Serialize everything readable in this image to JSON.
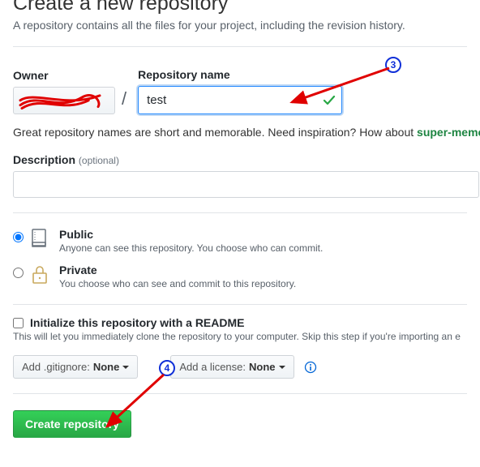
{
  "heading": "Create a new repository",
  "subheading": "A repository contains all the files for your project, including the revision history.",
  "owner": {
    "label": "Owner"
  },
  "repo": {
    "label": "Repository name",
    "value": "test"
  },
  "hint": {
    "text": "Great repository names are short and memorable. Need inspiration? How about ",
    "suggestion": "super-meme"
  },
  "description": {
    "label": "Description",
    "optional": "(optional)"
  },
  "visibility": {
    "public": {
      "title": "Public",
      "sub": "Anyone can see this repository. You choose who can commit."
    },
    "private": {
      "title": "Private",
      "sub": "You choose who can see and commit to this repository."
    }
  },
  "init": {
    "title": "Initialize this repository with a README",
    "desc": "This will let you immediately clone the repository to your computer. Skip this step if you're importing an e"
  },
  "dropdowns": {
    "gitignore": {
      "prefix": "Add .gitignore: ",
      "value": "None"
    },
    "license": {
      "prefix": "Add a license: ",
      "value": "None"
    }
  },
  "create_label": "Create repository",
  "annotations": {
    "step3": "3",
    "step4": "4"
  }
}
